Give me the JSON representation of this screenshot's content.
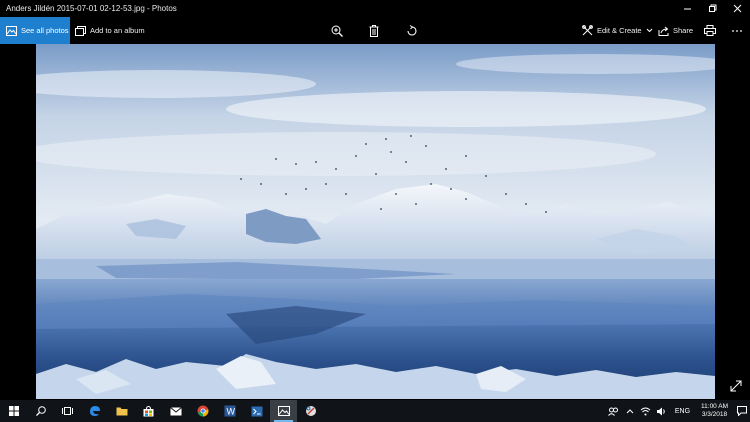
{
  "window": {
    "title": "Anders Jildén  2015-07-01 02-12-53.jpg - Photos"
  },
  "toolbar": {
    "see_all_label": "See all photos",
    "add_album_label": "Add to an album",
    "edit_create_label": "Edit & Create",
    "share_label": "Share"
  },
  "taskbar": {
    "language": "ENG",
    "time": "11:00 AM",
    "date": "3/3/2018"
  },
  "colors": {
    "accent": "#1f7fcf",
    "taskbar": "#101418"
  }
}
